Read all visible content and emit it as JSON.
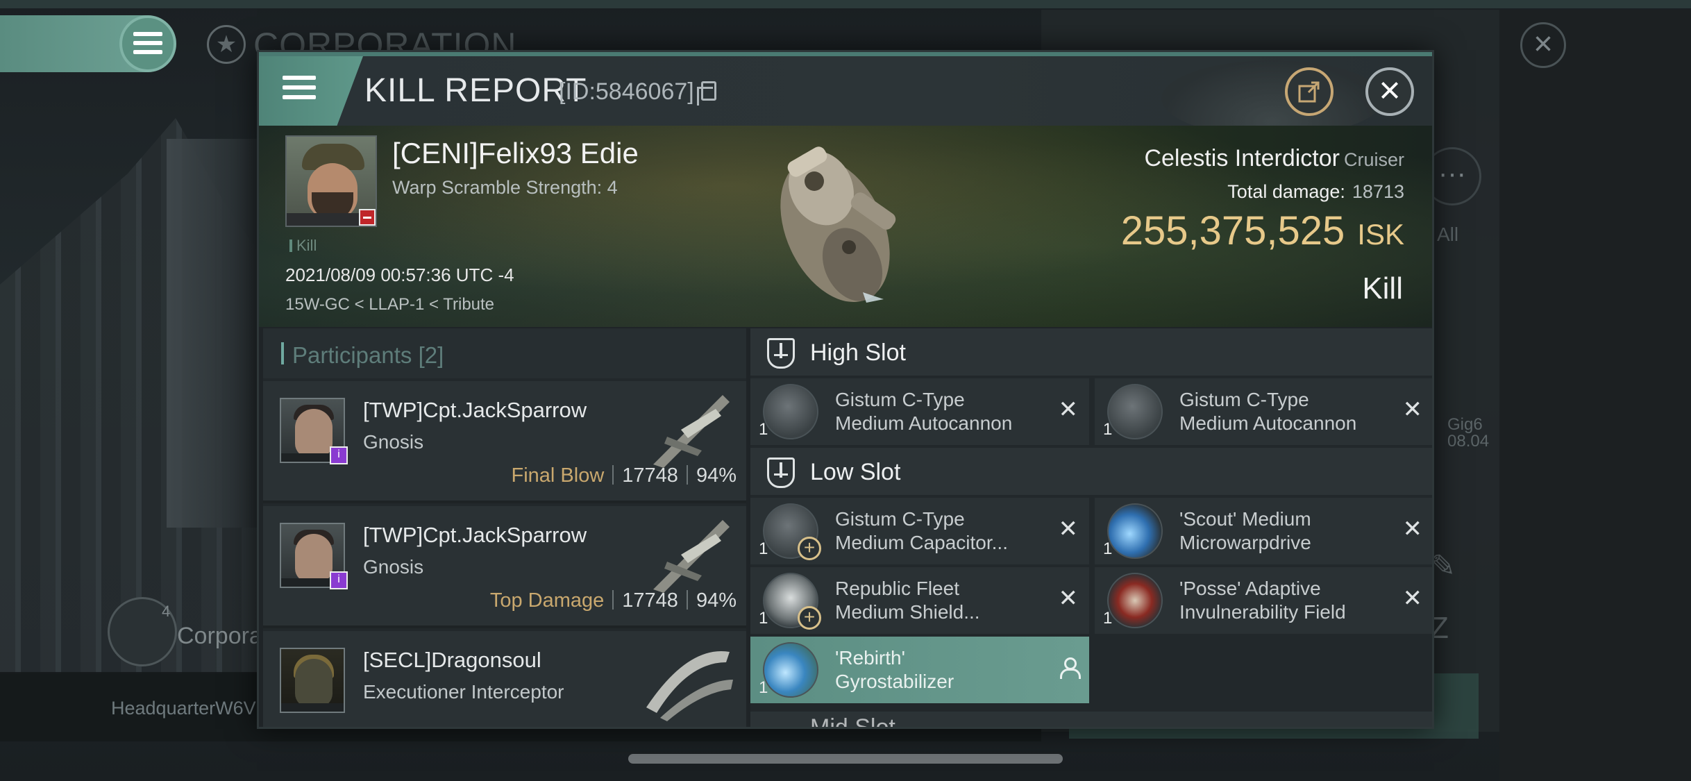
{
  "background": {
    "screen_title": "CORPORATION",
    "bottom_label": "Corpora",
    "bottom_count": "4",
    "footer_text": "HeadquarterW6V",
    "right_all_label": "All",
    "right_gig": "Gig6",
    "right_date": "08.04"
  },
  "header": {
    "title": "KILL REPORT",
    "report_id": "[ID:5846067]"
  },
  "victim": {
    "name": "[CENI]Felix93 Edie",
    "warp_scramble": "Warp Scramble Strength: 4",
    "tag": "Kill",
    "datetime": "2021/08/09 00:57:36 UTC -4",
    "location": "15W-GC < LLAP-1 < Tribute",
    "ship_name": "Celestis Interdictor",
    "ship_class": "Cruiser",
    "damage_label": "Total damage:",
    "damage_value": "18713",
    "isk_value": "255,375,525",
    "isk_unit": "ISK",
    "status": "Kill"
  },
  "participants": {
    "title": "Participants",
    "count": "[2]",
    "items": [
      {
        "name": "[TWP]Cpt.JackSparrow",
        "ship": "Gnosis",
        "role": "Final Blow",
        "damage": "17748",
        "percent": "94%"
      },
      {
        "name": "[TWP]Cpt.JackSparrow",
        "ship": "Gnosis",
        "role": "Top Damage",
        "damage": "17748",
        "percent": "94%"
      },
      {
        "name": "[SECL]Dragonsoul",
        "ship": "Executioner Interceptor"
      }
    ]
  },
  "slots": {
    "high": {
      "title": "High Slot",
      "modules": [
        {
          "qty": "1",
          "line1": "Gistum C-Type",
          "line2": "Medium Autocannon"
        },
        {
          "qty": "1",
          "line1": "Gistum C-Type",
          "line2": "Medium Autocannon"
        }
      ]
    },
    "low": {
      "title": "Low Slot",
      "modules": [
        {
          "qty": "1",
          "line1": "Gistum C-Type",
          "line2": "Medium Capacitor..."
        },
        {
          "qty": "1",
          "line1": "'Scout' Medium",
          "line2": "Microwarpdrive"
        },
        {
          "qty": "1",
          "line1": "Republic Fleet",
          "line2": "Medium Shield..."
        },
        {
          "qty": "1",
          "line1": "'Posse' Adaptive",
          "line2": "Invulnerability Field"
        },
        {
          "qty": "1",
          "line1": "'Rebirth'",
          "line2": "Gyrostabilizer"
        }
      ]
    },
    "mid": {
      "title": "Mid Slot"
    }
  },
  "colors": {
    "accent_teal": "#5f988a",
    "isk_gold": "#e7c98a",
    "role_gold": "#c9a86e"
  }
}
